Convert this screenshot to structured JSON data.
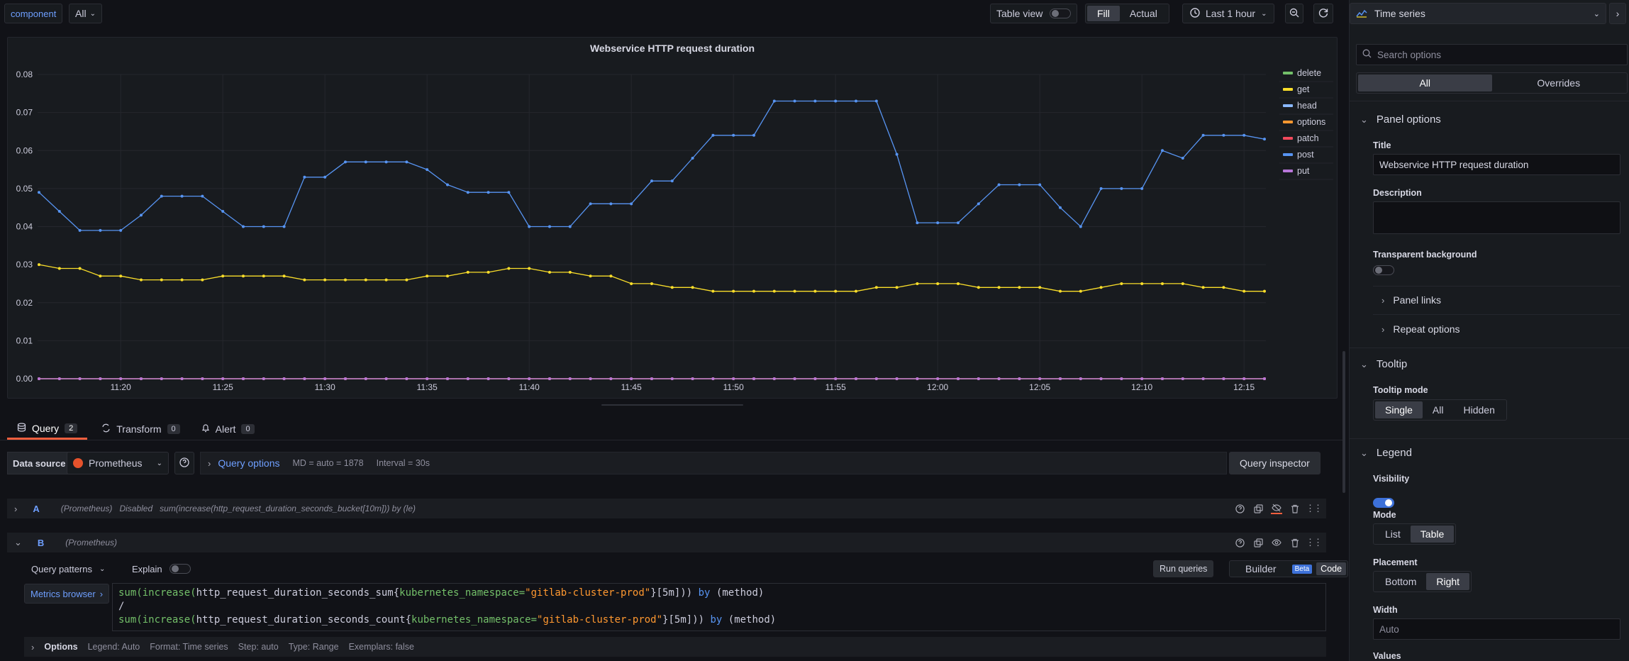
{
  "toolbar": {
    "variable_label": "component",
    "variable_value": "All",
    "table_view_label": "Table view",
    "fill_label": "Fill",
    "actual_label": "Actual",
    "time_range": "Last 1 hour"
  },
  "panel": {
    "title": "Webservice HTTP request duration"
  },
  "chart_data": {
    "type": "line",
    "title": "Webservice HTTP request duration",
    "ylim": [
      0,
      0.08
    ],
    "y_ticks": [
      "0.00",
      "0.01",
      "0.02",
      "0.03",
      "0.04",
      "0.05",
      "0.06",
      "0.07",
      "0.08"
    ],
    "x_ticks": [
      "11:20",
      "11:25",
      "11:30",
      "11:35",
      "11:40",
      "11:45",
      "11:50",
      "11:55",
      "12:00",
      "12:05",
      "12:10",
      "12:15"
    ],
    "x_start": "11:16",
    "x_step_seconds": 60,
    "legend_placement": "right",
    "grid": true,
    "series": [
      {
        "name": "delete",
        "color": "#73bf69",
        "values": [
          0,
          0,
          0,
          0,
          0,
          0,
          0,
          0,
          0,
          0,
          0,
          0,
          0,
          0,
          0,
          0,
          0,
          0,
          0,
          0,
          0,
          0,
          0,
          0,
          0,
          0,
          0,
          0,
          0,
          0,
          0,
          0,
          0,
          0,
          0,
          0,
          0,
          0,
          0,
          0,
          0,
          0,
          0,
          0,
          0,
          0,
          0,
          0,
          0,
          0,
          0,
          0,
          0,
          0,
          0,
          0,
          0,
          0,
          0,
          0,
          0
        ]
      },
      {
        "name": "get",
        "color": "#fade2a",
        "values": [
          0.03,
          0.029,
          0.029,
          0.027,
          0.027,
          0.026,
          0.026,
          0.026,
          0.026,
          0.027,
          0.027,
          0.027,
          0.027,
          0.026,
          0.026,
          0.026,
          0.026,
          0.026,
          0.026,
          0.027,
          0.027,
          0.028,
          0.028,
          0.029,
          0.029,
          0.028,
          0.028,
          0.027,
          0.027,
          0.025,
          0.025,
          0.024,
          0.024,
          0.023,
          0.023,
          0.023,
          0.023,
          0.023,
          0.023,
          0.023,
          0.023,
          0.024,
          0.024,
          0.025,
          0.025,
          0.025,
          0.024,
          0.024,
          0.024,
          0.024,
          0.023,
          0.023,
          0.024,
          0.025,
          0.025,
          0.025,
          0.025,
          0.024,
          0.024,
          0.023,
          0.023
        ]
      },
      {
        "name": "head",
        "color": "#8ab8ff",
        "values": [
          0,
          0,
          0,
          0,
          0,
          0,
          0,
          0,
          0,
          0,
          0,
          0,
          0,
          0,
          0,
          0,
          0,
          0,
          0,
          0,
          0,
          0,
          0,
          0,
          0,
          0,
          0,
          0,
          0,
          0,
          0,
          0,
          0,
          0,
          0,
          0,
          0,
          0,
          0,
          0,
          0,
          0,
          0,
          0,
          0,
          0,
          0,
          0,
          0,
          0,
          0,
          0,
          0,
          0,
          0,
          0,
          0,
          0,
          0,
          0,
          0
        ]
      },
      {
        "name": "options",
        "color": "#ff9830",
        "values": [
          0,
          0,
          0,
          0,
          0,
          0,
          0,
          0,
          0,
          0,
          0,
          0,
          0,
          0,
          0,
          0,
          0,
          0,
          0,
          0,
          0,
          0,
          0,
          0,
          0,
          0,
          0,
          0,
          0,
          0,
          0,
          0,
          0,
          0,
          0,
          0,
          0,
          0,
          0,
          0,
          0,
          0,
          0,
          0,
          0,
          0,
          0,
          0,
          0,
          0,
          0,
          0,
          0,
          0,
          0,
          0,
          0,
          0,
          0,
          0,
          0
        ]
      },
      {
        "name": "patch",
        "color": "#f2495c",
        "values": [
          0,
          0,
          0,
          0,
          0,
          0,
          0,
          0,
          0,
          0,
          0,
          0,
          0,
          0,
          0,
          0,
          0,
          0,
          0,
          0,
          0,
          0,
          0,
          0,
          0,
          0,
          0,
          0,
          0,
          0,
          0,
          0,
          0,
          0,
          0,
          0,
          0,
          0,
          0,
          0,
          0,
          0,
          0,
          0,
          0,
          0,
          0,
          0,
          0,
          0,
          0,
          0,
          0,
          0,
          0,
          0,
          0,
          0,
          0,
          0,
          0
        ]
      },
      {
        "name": "post",
        "color": "#5794f2",
        "values": [
          0.049,
          0.044,
          0.039,
          0.039,
          0.039,
          0.043,
          0.048,
          0.048,
          0.048,
          0.044,
          0.04,
          0.04,
          0.04,
          0.053,
          0.053,
          0.057,
          0.057,
          0.057,
          0.057,
          0.055,
          0.051,
          0.049,
          0.049,
          0.049,
          0.04,
          0.04,
          0.04,
          0.046,
          0.046,
          0.046,
          0.052,
          0.052,
          0.058,
          0.064,
          0.064,
          0.064,
          0.073,
          0.073,
          0.073,
          0.073,
          0.073,
          0.073,
          0.059,
          0.041,
          0.041,
          0.041,
          0.046,
          0.051,
          0.051,
          0.051,
          0.045,
          0.04,
          0.05,
          0.05,
          0.05,
          0.06,
          0.058,
          0.064,
          0.064,
          0.064,
          0.063
        ]
      },
      {
        "name": "put",
        "color": "#b877d9",
        "values": [
          0,
          0,
          0,
          0,
          0,
          0,
          0,
          0,
          0,
          0,
          0,
          0,
          0,
          0,
          0,
          0,
          0,
          0,
          0,
          0,
          0,
          0,
          0,
          0,
          0,
          0,
          0,
          0,
          0,
          0,
          0,
          0,
          0,
          0,
          0,
          0,
          0,
          0,
          0,
          0,
          0,
          0,
          0,
          0,
          0,
          0,
          0,
          0,
          0,
          0,
          0,
          0,
          0,
          0,
          0,
          0,
          0,
          0,
          0,
          0,
          0
        ]
      }
    ]
  },
  "tabs": [
    {
      "label": "Query",
      "count": "2"
    },
    {
      "label": "Transform",
      "count": "0"
    },
    {
      "label": "Alert",
      "count": "0"
    }
  ],
  "datasource": {
    "label": "Data source",
    "name": "Prometheus",
    "query_options": "Query options",
    "md": "MD = auto = 1878",
    "interval": "Interval = 30s",
    "inspector": "Query inspector"
  },
  "queries": {
    "a": {
      "letter": "A",
      "source": "(Prometheus)",
      "status": "Disabled",
      "expr": "sum(increase(http_request_duration_seconds_bucket[10m])) by (le)"
    },
    "b": {
      "letter": "B",
      "source": "(Prometheus)",
      "patterns": "Query patterns",
      "explain": "Explain",
      "run": "Run queries",
      "builder": "Builder",
      "beta": "Beta",
      "code": "Code",
      "metrics_browser": "Metrics browser",
      "line1": {
        "fn1": "sum(",
        "fn2": "increase(",
        "metric": "http_request_duration_seconds_sum{",
        "label": "kubernetes_namespace=",
        "val": "\"gitlab-cluster-prod\"",
        "tail": "}[5m])) ",
        "by": "by",
        "grp": " (method)"
      },
      "line2": "/",
      "line3": {
        "fn1": "sum(",
        "fn2": "increase(",
        "metric": "http_request_duration_seconds_count{",
        "label": "kubernetes_namespace=",
        "val": "\"gitlab-cluster-prod\"",
        "tail": "}[5m])) ",
        "by": "by",
        "grp": " (method)"
      },
      "options": "Options",
      "opt_legend": "Legend: Auto",
      "opt_format": "Format: Time series",
      "opt_step": "Step: auto",
      "opt_type": "Type: Range",
      "opt_exemplars": "Exemplars: false"
    }
  },
  "sidebar": {
    "viz": "Time series",
    "search_placeholder": "Search options",
    "all": "All",
    "overrides": "Overrides",
    "panel_options": "Panel options",
    "title_label": "Title",
    "title_value": "Webservice HTTP request duration",
    "description_label": "Description",
    "transparent_label": "Transparent background",
    "panel_links": "Panel links",
    "repeat_options": "Repeat options",
    "tooltip": "Tooltip",
    "tooltip_mode": "Tooltip mode",
    "tt_single": "Single",
    "tt_all": "All",
    "tt_hidden": "Hidden",
    "legend": "Legend",
    "visibility": "Visibility",
    "mode": "Mode",
    "mode_list": "List",
    "mode_table": "Table",
    "placement": "Placement",
    "pl_bottom": "Bottom",
    "pl_right": "Right",
    "width": "Width",
    "width_placeholder": "Auto",
    "values": "Values"
  }
}
